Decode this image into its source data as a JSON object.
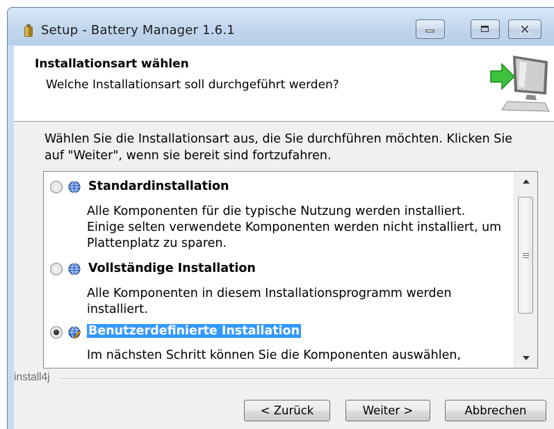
{
  "window": {
    "title": "Setup - Battery Manager 1.6.1"
  },
  "header": {
    "title": "Installationsart wählen",
    "subtitle": "Welche Installationsart soll durchgeführt werden?"
  },
  "intro_text": "Wählen Sie die Installationsart aus, die Sie durchführen möchten. Klicken Sie auf \"Weiter\", wenn sie bereit sind fortzufahren.",
  "options": [
    {
      "title": "Standardinstallation",
      "description": "Alle Komponenten für die typische Nutzung werden installiert. Einige selten verwendete Komponenten werden nicht installiert, um Plattenplatz zu sparen.",
      "selected": false
    },
    {
      "title": "Vollständige Installation",
      "description": "Alle Komponenten in diesem Installationsprogramm werden installiert.",
      "selected": false
    },
    {
      "title": "Benutzerdefinierte Installation",
      "description": "Im nächsten Schritt können Sie die Komponenten auswählen,",
      "selected": true
    }
  ],
  "brand": "install4j",
  "buttons": {
    "back": "< Zurück",
    "next": "Weiter >",
    "cancel": "Abbrechen"
  },
  "icons": {
    "app": "battery-icon",
    "header": "computer-arrow-icon",
    "option": "globe-icon",
    "selected_option": "globe-edit-icon"
  },
  "colors": {
    "selection": "#3399ff",
    "titlebar": "#c3d8ee",
    "dialog_bg": "#f0f0f0"
  }
}
